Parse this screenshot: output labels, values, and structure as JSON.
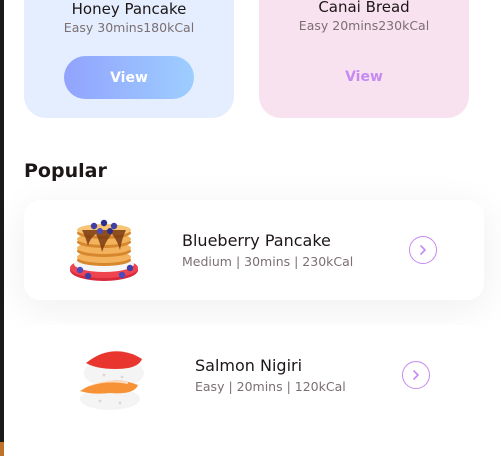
{
  "recommend_cards": [
    {
      "title": "Honey Pancake",
      "meta": "Easy 30mins180kCal",
      "button": "View"
    },
    {
      "title": "Canai Bread",
      "meta": "Easy 20mins230kCal",
      "button": "View"
    }
  ],
  "section": {
    "title": "Popular"
  },
  "popular": [
    {
      "name": "Blueberry Pancake",
      "meta": "Medium | 30mins | 230kCal",
      "icon": "pancake-image"
    },
    {
      "name": "Salmon Nigiri",
      "meta": "Easy | 20mins | 120kCal",
      "icon": "salmon-nigiri-image"
    }
  ],
  "colors": {
    "accent_blue": "#92a3fd",
    "accent_purple": "#c58bf2",
    "card_blue": "#e4eefe",
    "card_pink": "#f8e2ef"
  }
}
